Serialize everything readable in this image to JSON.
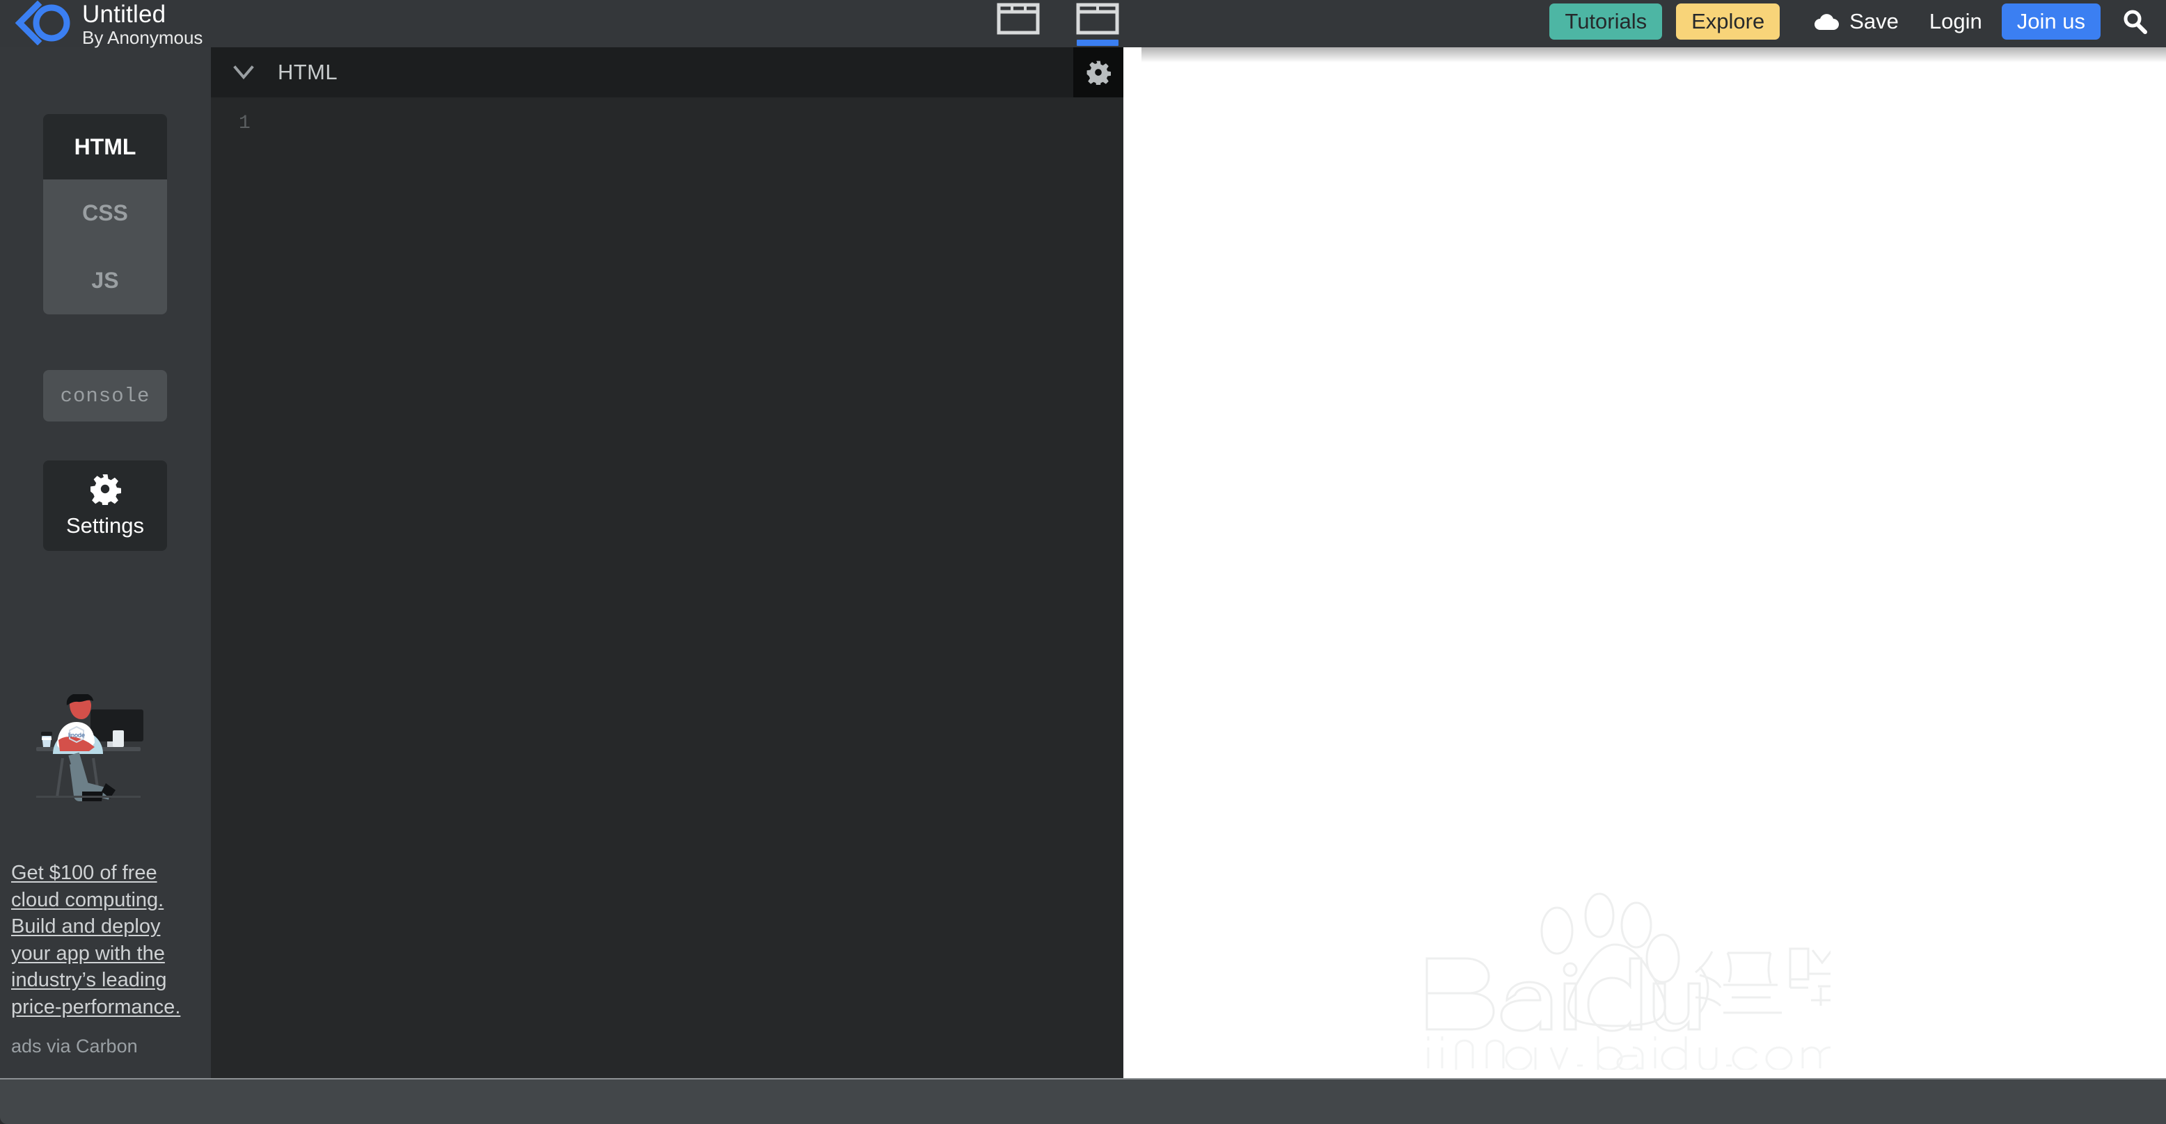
{
  "app": {
    "logo_icon": "back-circle-logo-icon",
    "accent_blue": "#3b7ff2",
    "header_bg": "#34373a"
  },
  "header": {
    "project_title": "Untitled",
    "project_author": "By Anonymous",
    "layout_buttons": [
      {
        "name": "layout-split-view",
        "icon": "layout-columns-icon",
        "active": false
      },
      {
        "name": "layout-editor-preview",
        "icon": "layout-rows-icon",
        "active": true
      }
    ],
    "nav": {
      "tutorials_label": "Tutorials",
      "tutorials_color": "#4db6a4",
      "explore_label": "Explore",
      "explore_color": "#f8d479",
      "save_label": "Save",
      "save_icon": "cloud-icon",
      "login_label": "Login",
      "join_label": "Join us",
      "join_color": "#3b7ff2",
      "search_icon": "search-icon"
    }
  },
  "sidebar": {
    "languages": [
      {
        "label": "HTML",
        "active": true
      },
      {
        "label": "CSS",
        "active": false
      },
      {
        "label": "JS",
        "active": false
      }
    ],
    "console_label": "console",
    "settings_label": "Settings",
    "settings_icon": "gear-icon",
    "ad": {
      "image_alt": "person-at-desk-illustration",
      "brand_on_shirt": "linode",
      "text": "Get $100 of free cloud computing. Build and deploy your app with the industry’s leading price-performance.",
      "via_label": "ads via Carbon"
    }
  },
  "editor": {
    "collapse_icon": "chevron-down-icon",
    "title": "HTML",
    "settings_icon": "gear-icon",
    "line_numbers": [
      "1"
    ],
    "content": ""
  },
  "preview": {
    "background": "#ffffff",
    "watermark_primary": "Baidu 经验",
    "watermark_secondary": "jingyan.baidu.com"
  },
  "status_bar": {
    "text": ""
  }
}
